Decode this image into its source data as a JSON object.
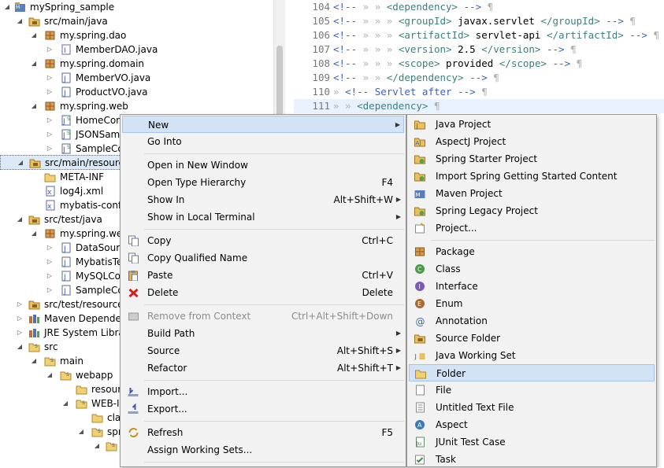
{
  "explorer": {
    "items": [
      {
        "label": "mySpring_sample",
        "icon": "maven-project-icon"
      },
      {
        "label": "src/main/java",
        "icon": "source-folder-icon"
      },
      {
        "label": "my.spring.dao",
        "icon": "package-icon"
      },
      {
        "label": "MemberDAO.java",
        "icon": "interface-file-icon"
      },
      {
        "label": "my.spring.domain",
        "icon": "package-icon"
      },
      {
        "label": "MemberVO.java",
        "icon": "java-file-icon"
      },
      {
        "label": "ProductVO.java",
        "icon": "java-file-icon"
      },
      {
        "label": "my.spring.web",
        "icon": "package-icon"
      },
      {
        "label": "HomeConf",
        "icon": "spring-java-file-icon"
      },
      {
        "label": "JSONSamp",
        "icon": "spring-java-file-icon"
      },
      {
        "label": "SampleCo",
        "icon": "spring-java-file-icon"
      },
      {
        "label": "src/main/resource",
        "icon": "source-folder-icon"
      },
      {
        "label": "META-INF",
        "icon": "folder-icon"
      },
      {
        "label": "log4j.xml",
        "icon": "xml-file-icon"
      },
      {
        "label": "mybatis-confi",
        "icon": "xml-file-icon"
      },
      {
        "label": "src/test/java",
        "icon": "source-folder-icon"
      },
      {
        "label": "my.spring.web",
        "icon": "package-icon"
      },
      {
        "label": "DataSourc",
        "icon": "java-file-icon"
      },
      {
        "label": "MybatisTes",
        "icon": "java-file-icon"
      },
      {
        "label": "MySQLCor",
        "icon": "java-file-icon"
      },
      {
        "label": "SampleCo",
        "icon": "java-file-icon"
      },
      {
        "label": "src/test/resources",
        "icon": "source-folder-icon"
      },
      {
        "label": "Maven Dependen",
        "icon": "library-icon"
      },
      {
        "label": "JRE System Librar",
        "icon": "library-icon"
      },
      {
        "label": "src",
        "icon": "folder-icon"
      },
      {
        "label": "main",
        "icon": "folder-icon"
      },
      {
        "label": "webapp",
        "icon": "folder-icon"
      },
      {
        "label": "resour",
        "icon": "folder-icon"
      },
      {
        "label": "WEB-IN",
        "icon": "folder-icon"
      },
      {
        "label": "clas",
        "icon": "folder-icon"
      },
      {
        "label": "spri",
        "icon": "folder-icon"
      },
      {
        "label": "",
        "icon": "folder-icon"
      }
    ]
  },
  "editor": {
    "lines": [
      {
        "num": "104",
        "parts": [
          "<!--",
          "»",
          "»",
          "<dependency>",
          "-->"
        ]
      },
      {
        "num": "105",
        "parts": [
          "<!--",
          "»",
          "»",
          "»",
          "<groupId>",
          "javax.servlet",
          "</groupId>",
          "-->"
        ]
      },
      {
        "num": "106",
        "parts": [
          "<!--",
          "»",
          "»",
          "»",
          "<artifactId>",
          "servlet-api",
          "</artifactId>",
          "-->"
        ]
      },
      {
        "num": "107",
        "parts": [
          "<!--",
          "»",
          "»",
          "»",
          "<version>",
          "2.5",
          "</version>",
          "-->"
        ]
      },
      {
        "num": "108",
        "parts": [
          "<!--",
          "»",
          "»",
          "»",
          "<scope>",
          "provided",
          "</scope>",
          "-->"
        ]
      },
      {
        "num": "109",
        "parts": [
          "<!--",
          "»",
          "»",
          "</dependency>",
          "-->"
        ]
      },
      {
        "num": "110",
        "parts": [
          "»",
          "<!--",
          "Servlet",
          "after",
          "-->"
        ]
      },
      {
        "num": "111",
        "parts": [
          "»",
          "»",
          "<dependency>"
        ]
      }
    ],
    "pilcrow": "¶"
  },
  "context_menu": {
    "items": [
      {
        "label": "New",
        "shortcut": "",
        "arrow": true,
        "icon": "",
        "disabled": false
      },
      {
        "label": "Go Into",
        "shortcut": "",
        "arrow": false,
        "icon": "",
        "disabled": false
      },
      {
        "label": "Open in New Window",
        "shortcut": "",
        "arrow": false,
        "icon": "",
        "disabled": false
      },
      {
        "label": "Open Type Hierarchy",
        "shortcut": "F4",
        "arrow": false,
        "icon": "",
        "disabled": false
      },
      {
        "label": "Show In",
        "shortcut": "Alt+Shift+W",
        "arrow": true,
        "icon": "",
        "disabled": false
      },
      {
        "label": "Show in Local Terminal",
        "shortcut": "",
        "arrow": true,
        "icon": "",
        "disabled": false
      },
      {
        "label": "Copy",
        "shortcut": "Ctrl+C",
        "arrow": false,
        "icon": "copy-icon",
        "disabled": false
      },
      {
        "label": "Copy Qualified Name",
        "shortcut": "",
        "arrow": false,
        "icon": "copy-icon",
        "disabled": false
      },
      {
        "label": "Paste",
        "shortcut": "Ctrl+V",
        "arrow": false,
        "icon": "paste-icon",
        "disabled": false
      },
      {
        "label": "Delete",
        "shortcut": "Delete",
        "arrow": false,
        "icon": "delete-icon",
        "disabled": false
      },
      {
        "label": "Remove from Context",
        "shortcut": "Ctrl+Alt+Shift+Down",
        "arrow": false,
        "icon": "remove-context-icon",
        "disabled": true
      },
      {
        "label": "Build Path",
        "shortcut": "",
        "arrow": true,
        "icon": "",
        "disabled": false
      },
      {
        "label": "Source",
        "shortcut": "Alt+Shift+S",
        "arrow": true,
        "icon": "",
        "disabled": false
      },
      {
        "label": "Refactor",
        "shortcut": "Alt+Shift+T",
        "arrow": true,
        "icon": "",
        "disabled": false
      },
      {
        "label": "Import...",
        "shortcut": "",
        "arrow": false,
        "icon": "import-icon",
        "disabled": false
      },
      {
        "label": "Export...",
        "shortcut": "",
        "arrow": false,
        "icon": "export-icon",
        "disabled": false
      },
      {
        "label": "Refresh",
        "shortcut": "F5",
        "arrow": false,
        "icon": "refresh-icon",
        "disabled": false
      },
      {
        "label": "Assign Working Sets...",
        "shortcut": "",
        "arrow": false,
        "icon": "",
        "disabled": false
      }
    ]
  },
  "submenu": {
    "items": [
      {
        "label": "Java Project",
        "icon": "java-project-icon"
      },
      {
        "label": "AspectJ Project",
        "icon": "aspectj-project-icon"
      },
      {
        "label": "Spring Starter Project",
        "icon": "spring-starter-icon"
      },
      {
        "label": "Import Spring Getting Started Content",
        "icon": "spring-import-icon"
      },
      {
        "label": "Maven Project",
        "icon": "maven-project-icon"
      },
      {
        "label": "Spring Legacy Project",
        "icon": "spring-legacy-icon"
      },
      {
        "label": "Project...",
        "icon": "project-icon"
      },
      {
        "label": "Package",
        "icon": "package-icon"
      },
      {
        "label": "Class",
        "icon": "class-icon"
      },
      {
        "label": "Interface",
        "icon": "interface-icon"
      },
      {
        "label": "Enum",
        "icon": "enum-icon"
      },
      {
        "label": "Annotation",
        "icon": "annotation-icon"
      },
      {
        "label": "Source Folder",
        "icon": "source-folder-icon"
      },
      {
        "label": "Java Working Set",
        "icon": "working-set-icon"
      },
      {
        "label": "Folder",
        "icon": "folder-icon",
        "highlighted": true
      },
      {
        "label": "File",
        "icon": "file-icon"
      },
      {
        "label": "Untitled Text File",
        "icon": "text-file-icon"
      },
      {
        "label": "Aspect",
        "icon": "aspect-icon"
      },
      {
        "label": "JUnit Test Case",
        "icon": "junit-icon"
      },
      {
        "label": "Task",
        "icon": "task-icon"
      }
    ]
  },
  "colors": {
    "accent": "#3c78c0",
    "highlight": "#d3e3f6",
    "comment": "#3f5fbf",
    "tag": "#3f7f7f"
  }
}
